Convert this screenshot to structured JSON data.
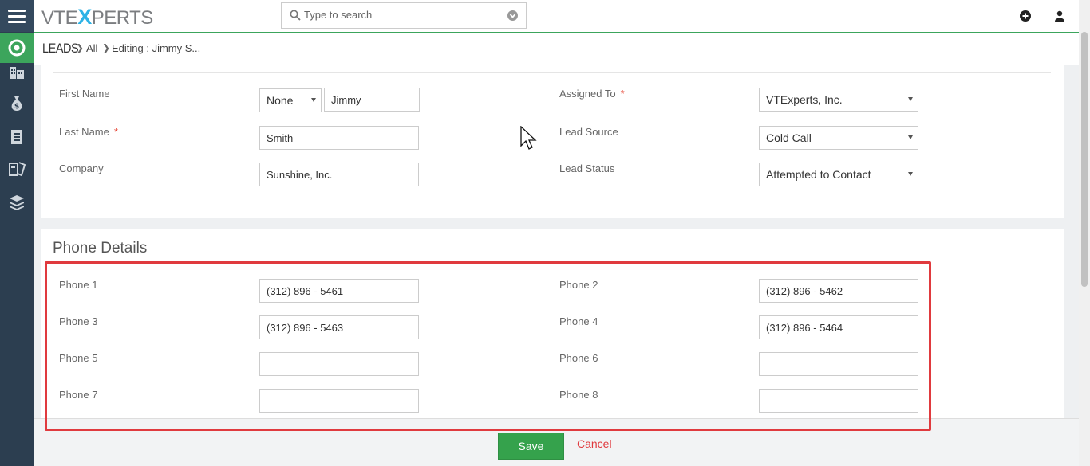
{
  "app": {
    "logo_left": "VTE",
    "logo_x": "X",
    "logo_right": "PERTS"
  },
  "search": {
    "placeholder": "Type to search"
  },
  "breadcrumb": {
    "module": "LEADS",
    "items": [
      "All",
      "Editing : Jimmy S..."
    ]
  },
  "basic": {
    "first_name_label": "First Name",
    "salutation": "None",
    "first_name": "Jimmy",
    "last_name_label": "Last Name",
    "last_name": "Smith",
    "company_label": "Company",
    "company": "Sunshine, Inc.",
    "assigned_to_label": "Assigned To",
    "assigned_to": "VTExperts, Inc.",
    "lead_source_label": "Lead Source",
    "lead_source": "Cold Call",
    "lead_status_label": "Lead Status",
    "lead_status": "Attempted to Contact",
    "required_mark": "*"
  },
  "phone": {
    "title": "Phone Details",
    "fields": [
      {
        "label": "Phone 1",
        "value": "(312) 896 - 5461"
      },
      {
        "label": "Phone 2",
        "value": "(312) 896 - 5462"
      },
      {
        "label": "Phone 3",
        "value": "(312) 896 - 5463"
      },
      {
        "label": "Phone 4",
        "value": "(312) 896 - 5464"
      },
      {
        "label": "Phone 5",
        "value": ""
      },
      {
        "label": "Phone 6",
        "value": ""
      },
      {
        "label": "Phone 7",
        "value": ""
      },
      {
        "label": "Phone 8",
        "value": ""
      }
    ]
  },
  "footer": {
    "save": "Save",
    "cancel": "Cancel"
  },
  "colors": {
    "accent": "#3ca55c",
    "sidebar": "#2c3e50",
    "highlight": "#e03a3e",
    "required": "#e74c3c"
  },
  "icons": [
    "menu-icon",
    "leads-icon",
    "organizations-icon",
    "money-bag-icon",
    "contacts-book-icon",
    "tickets-icon",
    "products-icon",
    "search-icon",
    "chevron-down-icon",
    "add-icon",
    "user-icon",
    "mouse-cursor-icon"
  ]
}
